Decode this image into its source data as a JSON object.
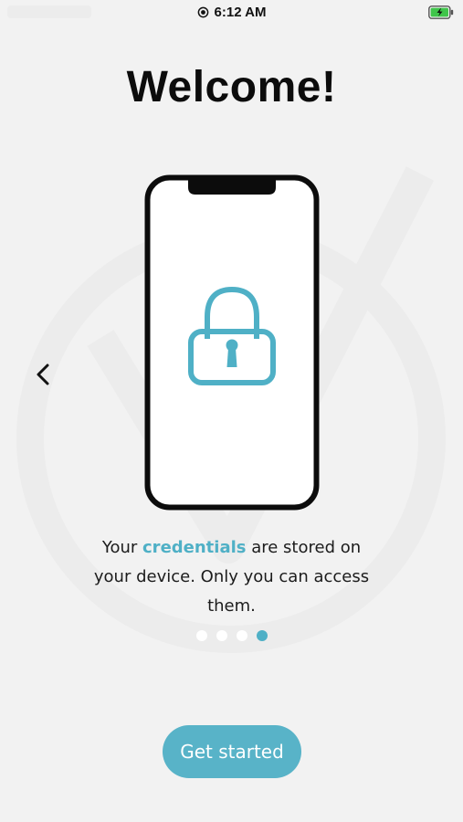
{
  "status_bar": {
    "time": "6:12 AM",
    "record_icon": "record-icon",
    "battery_icon": "battery-charging-icon"
  },
  "onboarding": {
    "title": "Welcome!",
    "description_before": "Your ",
    "description_highlight": "credentials",
    "description_after": " are stored on your device. Only you can access them.",
    "illustration_icons": [
      "phone-icon",
      "lock-icon"
    ],
    "back_icon": "chevron-left-icon",
    "page_count": 4,
    "current_page": 4,
    "button_label": "Get started"
  },
  "colors": {
    "background": "#f2f2f2",
    "accent": "#4fb0c6",
    "button": "#58b3c8",
    "button_text": "#ffffff",
    "dot_inactive": "#ffffff",
    "title": "#0c0c0c"
  }
}
